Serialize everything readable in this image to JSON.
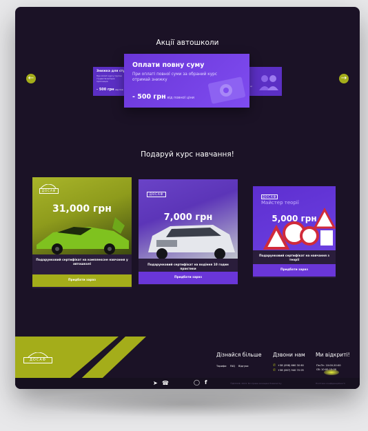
{
  "promos": {
    "title": "Акції автошколи",
    "left": {
      "title": "Знижка для сту",
      "desc": "При оплаті курсу групою студентів вигідна пропозиція",
      "price": "- 500 грн",
      "price_suffix": "від пов"
    },
    "main": {
      "title": "Оплати повну суму",
      "desc": "При оплаті повної суми за обраний курс отримай знижку",
      "price": "- 500 грн",
      "price_suffix": "від повної ціни"
    },
    "right": {
      "desc": "ці"
    },
    "colors": {
      "accent": "#a4ad1a",
      "primary": "#6a36d8"
    },
    "arrows": {
      "prev_icon": "chevron-left-icon",
      "next_icon": "chevron-right-icon"
    }
  },
  "gift": {
    "title": "Подаруй курс навчання!",
    "logo_text": "ДОСАФ",
    "cards": [
      {
        "price": "31,000 грн",
        "caption": "Подарунковий сертифікат на комплексне навчання у автошколі",
        "button": "Придбати зараз"
      },
      {
        "price": "7,000 грн",
        "caption": "Подарунковий сертифікат на водіння 10 годин практики",
        "button": "Придбати зараз"
      },
      {
        "price": "5,000 грн",
        "caption": "Подарунковий сертифікат на навчання з теорії",
        "button": "Придбати зараз",
        "overlay": "Майстер теорії"
      }
    ]
  },
  "footer": {
    "logo_text": "ДОСАФ",
    "learn_more": {
      "title": "Дізнайся більше",
      "links": [
        "Тарифи",
        "FAQ",
        "Відгуки"
      ]
    },
    "call_us": {
      "title": "Дзвони нам",
      "phones": [
        "+38 (098) 660 30 60",
        "+38 (067) 940 70 05"
      ]
    },
    "open": {
      "title": "Ми відкриті!",
      "hours": [
        "Пн-Пт: 10:00-20:00",
        "Сб: 10:00-15:00"
      ]
    },
    "copyright": "©ДОСАФ, 2024. Всі права захищені Powered by",
    "policy": "Політика конфіденційності"
  }
}
